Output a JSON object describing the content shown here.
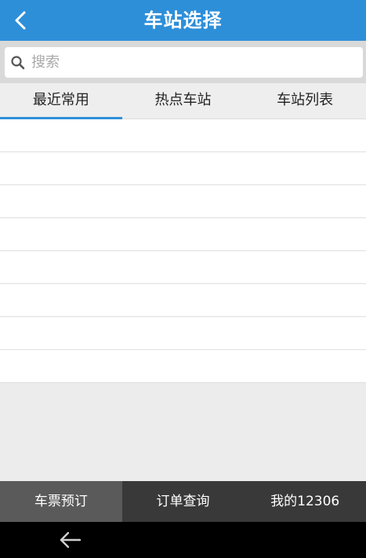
{
  "header": {
    "title": "车站选择",
    "back_icon": "chevron-left-icon"
  },
  "search": {
    "placeholder": "搜索",
    "value": "",
    "icon": "search-icon"
  },
  "tabs": [
    {
      "label": "最近常用",
      "active": true
    },
    {
      "label": "热点车站",
      "active": false
    },
    {
      "label": "车站列表",
      "active": false
    }
  ],
  "list": {
    "rows": [
      "",
      "",
      "",
      "",
      "",
      "",
      "",
      ""
    ]
  },
  "bottom_nav": [
    {
      "label": "车票预订",
      "active": true
    },
    {
      "label": "订单查询",
      "active": false
    },
    {
      "label": "我的12306",
      "active": false
    }
  ],
  "system_bar": {
    "back_icon": "arrow-left-icon"
  },
  "colors": {
    "accent": "#2e8fd9",
    "nav_bg": "#393939",
    "nav_active": "#5a5a5a"
  }
}
